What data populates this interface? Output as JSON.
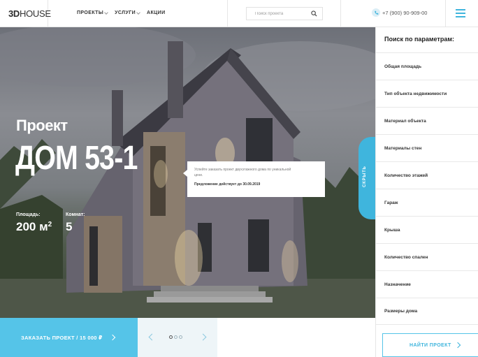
{
  "header": {
    "logo_3d": "3D",
    "logo_house": "HOUSE",
    "nav": [
      "ПРОЕКТЫ",
      "УСЛУГИ",
      "АКЦИИ"
    ],
    "search_placeholder": "Поиск проекта",
    "phone": "+7 (900) 90-909-00"
  },
  "hero": {
    "label": "Проект",
    "title": "ДОМ 53-1",
    "area_label": "Площадь:",
    "area_value": "200 м",
    "area_unit_sup": "2",
    "rooms_label": "Комнат:",
    "rooms_value": "5",
    "popup_text": "Успейте заказать проект двухэтажного дома по уникальной цене.",
    "popup_offer": "Предложение действует до 30.09.2019",
    "hide_tab": "СКРЫТЬ"
  },
  "order_button": "ЗАКАЗАТЬ ПРОЕКТ / 15 000 ₽",
  "slider": {
    "dots": 3,
    "active": 1
  },
  "panel": {
    "title": "Поиск по параметрам:",
    "filters": [
      "Общая площадь",
      "Тип объекта недвижимости",
      "Материал объекта",
      "Материалы стен",
      "Количество этажей",
      "Гараж",
      "Крыша",
      "Количество спален",
      "Назначение",
      "Размеры дома"
    ],
    "find_button": "НАЙТИ ПРОЕКТ"
  },
  "colors": {
    "accent": "#55c4e8",
    "accent_dark": "#3fb5dd"
  }
}
